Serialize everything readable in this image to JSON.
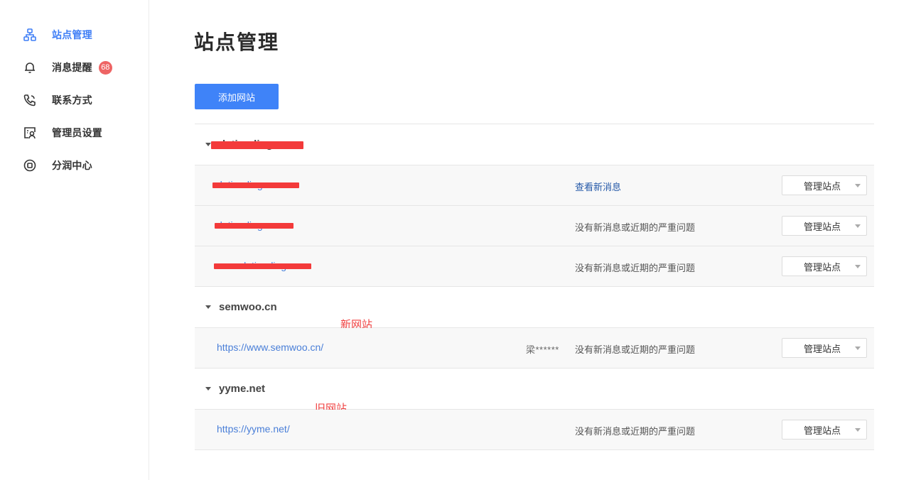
{
  "sidebar": {
    "items": [
      {
        "label": "站点管理",
        "icon": "sitemap-icon",
        "active": true
      },
      {
        "label": "消息提醒",
        "icon": "bell-icon",
        "badge": "68"
      },
      {
        "label": "联系方式",
        "icon": "phone-icon"
      },
      {
        "label": "管理员设置",
        "icon": "admin-card-icon"
      },
      {
        "label": "分润中心",
        "icon": "profit-share-icon"
      }
    ],
    "accent": "#3f7ef6",
    "badge_color": "#ee6464"
  },
  "main": {
    "title": "站点管理",
    "add_button": "添加网站",
    "manage_label": "管理站点",
    "groups": [
      {
        "name": "datianding",
        "rows": [
          {
            "url": "datianding",
            "status": "查看新消息"
          },
          {
            "url": "datianding",
            "status": "没有新消息或近期的严重问题"
          },
          {
            "url": "www.datianding.com",
            "status": "没有新消息或近期的严重问题"
          }
        ]
      },
      {
        "name": "semwoo.cn",
        "note": "新网站",
        "rows": [
          {
            "url": "https://www.semwoo.cn/",
            "owner": "梁******",
            "status": "没有新消息或近期的严重问题"
          }
        ]
      },
      {
        "name": "yyme.net",
        "note": "旧网站",
        "rows": [
          {
            "url": "https://yyme.net/",
            "status": "没有新消息或近期的严重问题"
          }
        ]
      }
    ]
  },
  "colors": {
    "primary_button": "#3f83f8",
    "link": "#4a7fd8",
    "redaction": "#f33a3a",
    "annotation": "#f04040"
  }
}
